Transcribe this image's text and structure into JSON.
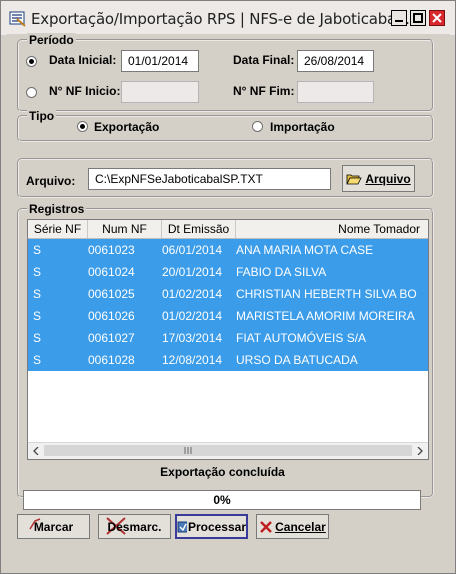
{
  "window": {
    "title": "Exportação/Importação RPS  |  NFS-e de Jaboticaba..."
  },
  "periodo": {
    "legend": "Período",
    "data_inicial_label": "Data Inicial:",
    "data_inicial_value": "01/01/2014",
    "data_final_label": "Data Final:",
    "data_final_value": "26/08/2014",
    "nf_inicio_label": "N° NF Inicio:",
    "nf_inicio_value": "",
    "nf_fim_label": "N° NF Fim:",
    "nf_fim_value": ""
  },
  "tipo": {
    "legend": "Tipo",
    "exportacao_label": "Exportação",
    "importacao_label": "Importação",
    "selected": "Exportação"
  },
  "arquivo": {
    "label": "Arquivo:",
    "value": "C:\\ExpNFSeJaboticabalSP.TXT",
    "button_label": "Arquivo"
  },
  "registros": {
    "legend": "Registros",
    "columns": [
      "Série NF",
      "Num NF",
      "Dt Emissão",
      "Nome Tomador"
    ],
    "rows": [
      [
        "S",
        "0061023",
        "06/01/2014",
        "ANA MARIA MOTA CASE"
      ],
      [
        "S",
        "0061024",
        "20/01/2014",
        "FABIO DA SILVA"
      ],
      [
        "S",
        "0061025",
        "01/02/2014",
        "CHRISTIAN HEBERTH SILVA  BO"
      ],
      [
        "S",
        "0061026",
        "01/02/2014",
        "MARISTELA AMORIM MOREIRA"
      ],
      [
        "S",
        "0061027",
        "17/03/2014",
        "FIAT AUTOMÓVEIS S/A"
      ],
      [
        "S",
        "0061028",
        "12/08/2014",
        "URSO DA BATUCADA"
      ]
    ]
  },
  "status": {
    "message": "Exportação concluída",
    "progress_text": "0%",
    "progress": 0
  },
  "actions": {
    "marcar": "Marcar",
    "desmarcar": "Desmarc.",
    "processar": "Processar",
    "cancelar": "Cancelar"
  },
  "colors": {
    "selection": "#3b9ce9",
    "close_button": "#d9282d"
  }
}
